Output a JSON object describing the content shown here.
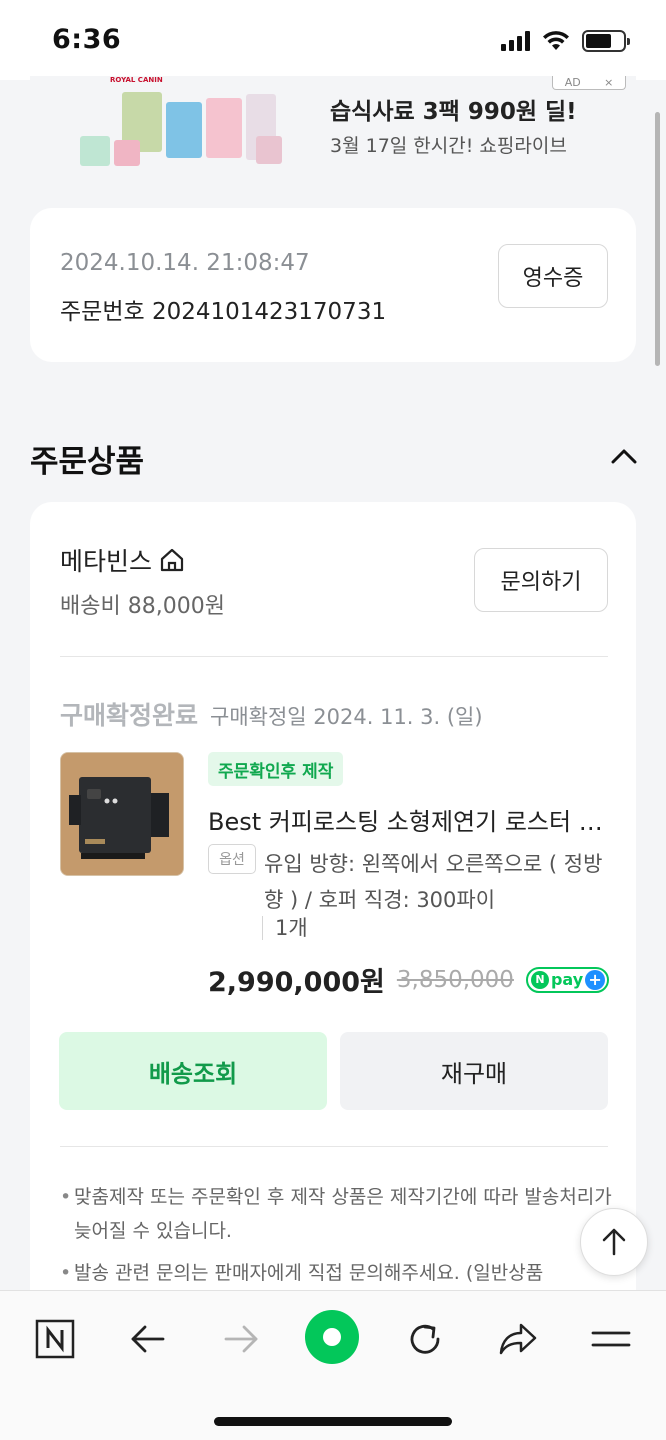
{
  "status_bar": {
    "time": "6:36"
  },
  "ad": {
    "badge_ad": "AD",
    "badge_close": "×",
    "brand_label": "ROYAL CANIN",
    "title": "습식사료 3팩 990원 딜!",
    "subtitle": "3월 17일 한시간! 쇼핑라이브"
  },
  "order": {
    "datetime": "2024.10.14. 21:08:47",
    "number": "주문번호 2024101423170731",
    "receipt_label": "영수증"
  },
  "section": {
    "title": "주문상품"
  },
  "seller": {
    "name": "메타빈스",
    "shipping_fee": "배송비 88,000원",
    "inquiry_label": "문의하기"
  },
  "item": {
    "status": "구매확정완료",
    "status_date": "구매확정일 2024. 11. 3. (일)",
    "tag": "주문확인후 제작",
    "name": "Best 커피로스팅 소형제연기 로스터 연기 제거기",
    "option_tag": "옵션",
    "option_text": "유입 방향: 왼쪽에서 오른쪽으로 ( 정방향 ) / 호퍼 직경: 300파이",
    "quantity": "1개",
    "price": "2,990,000원",
    "original_price": "3,850,000",
    "npay_n": "N",
    "npay_label": "pay",
    "npay_plus": "+"
  },
  "actions": {
    "track_label": "배송조회",
    "rebuy_label": "재구매"
  },
  "notices": [
    "맞춤제작 또는 주문확인 후 제작 상품은 제작기간에 따라 발송처리가 늦어질 수 있습니다.",
    "발송 관련 문의는 판매자에게 직접 문의해주세요. (일반상품"
  ],
  "toolbar": {
    "n_label": "N"
  },
  "colors": {
    "accent_green": "#03c75a",
    "track_bg": "#dcf9e4",
    "tag_bg": "#e4f8ea"
  }
}
